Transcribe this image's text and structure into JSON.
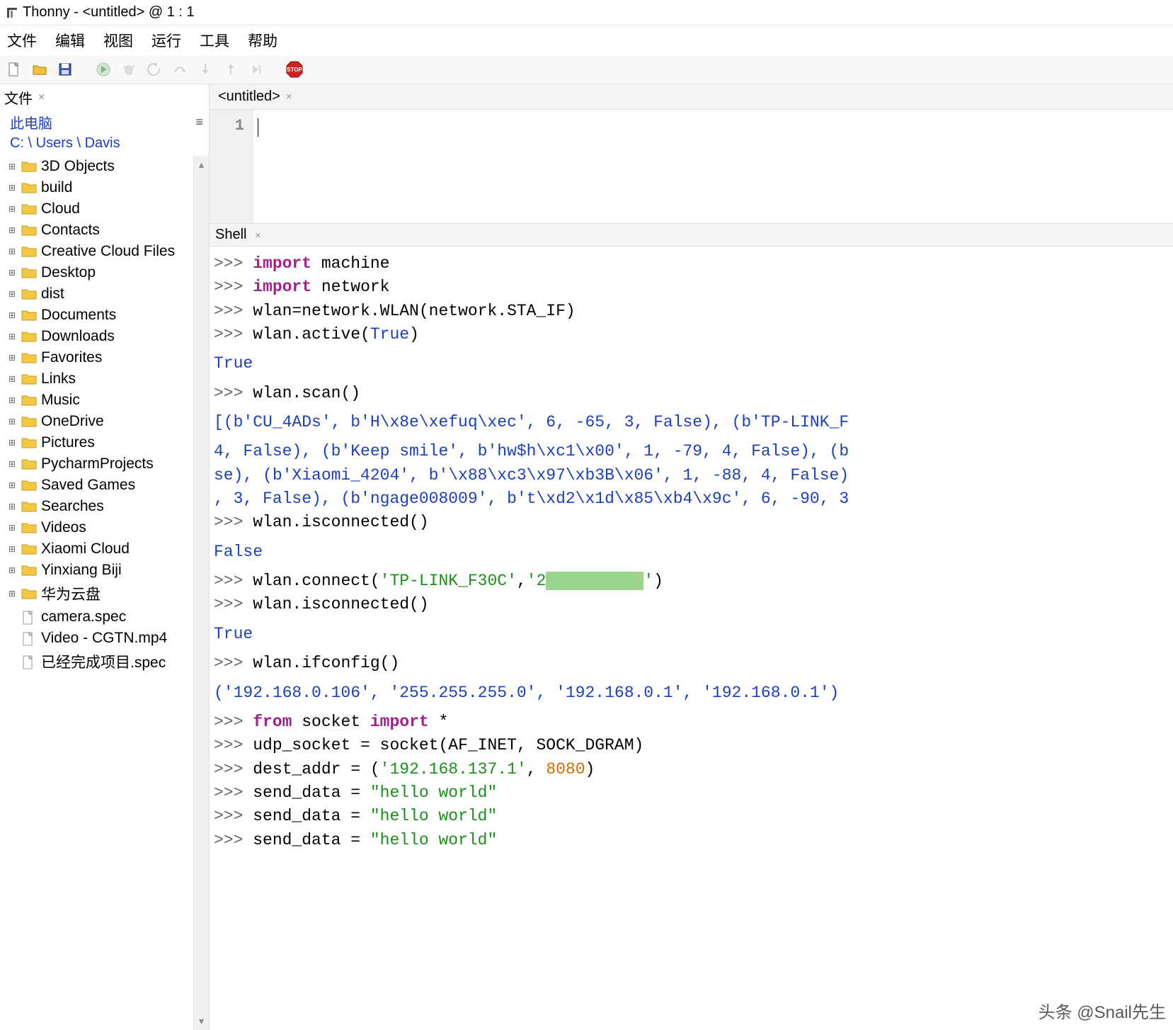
{
  "titlebar": {
    "text": "Thonny  -  <untitled>  @  1 : 1"
  },
  "menubar": {
    "items": [
      "文件",
      "编辑",
      "视图",
      "运行",
      "工具",
      "帮助"
    ]
  },
  "toolbar": {
    "buttons": [
      {
        "name": "new-file-icon"
      },
      {
        "name": "open-file-icon"
      },
      {
        "name": "save-file-icon"
      },
      {
        "name": "sep"
      },
      {
        "name": "run-icon"
      },
      {
        "name": "debug-icon"
      },
      {
        "name": "step-back-icon"
      },
      {
        "name": "step-over-icon"
      },
      {
        "name": "step-into-icon"
      },
      {
        "name": "step-out-icon"
      },
      {
        "name": "resume-icon"
      },
      {
        "name": "sep"
      },
      {
        "name": "stop-icon"
      }
    ]
  },
  "sidebar": {
    "tab_label": "文件",
    "location_label": "此电脑",
    "path": "C: \\ Users \\ Davis",
    "items": [
      {
        "type": "folder",
        "label": "3D Objects"
      },
      {
        "type": "folder",
        "label": "build"
      },
      {
        "type": "folder",
        "label": "Cloud"
      },
      {
        "type": "folder",
        "label": "Contacts"
      },
      {
        "type": "folder",
        "label": "Creative Cloud Files"
      },
      {
        "type": "folder",
        "label": "Desktop"
      },
      {
        "type": "folder",
        "label": "dist"
      },
      {
        "type": "folder",
        "label": "Documents"
      },
      {
        "type": "folder",
        "label": "Downloads"
      },
      {
        "type": "folder",
        "label": "Favorites"
      },
      {
        "type": "folder",
        "label": "Links"
      },
      {
        "type": "folder",
        "label": "Music"
      },
      {
        "type": "folder",
        "label": "OneDrive"
      },
      {
        "type": "folder",
        "label": "Pictures"
      },
      {
        "type": "folder",
        "label": "PycharmProjects"
      },
      {
        "type": "folder",
        "label": "Saved Games"
      },
      {
        "type": "folder",
        "label": "Searches"
      },
      {
        "type": "folder",
        "label": "Videos"
      },
      {
        "type": "folder",
        "label": "Xiaomi Cloud"
      },
      {
        "type": "folder",
        "label": "Yinxiang Biji"
      },
      {
        "type": "folder",
        "label": "华为云盘"
      },
      {
        "type": "file",
        "label": "camera.spec"
      },
      {
        "type": "file",
        "label": "Video - CGTN.mp4"
      },
      {
        "type": "file",
        "label": "已经完成项目.spec"
      }
    ]
  },
  "editor": {
    "tab_label": "<untitled>",
    "line_number": "1"
  },
  "shell": {
    "tab_label": "Shell",
    "lines": [
      {
        "t": "in",
        "tokens": [
          [
            "kw",
            "import"
          ],
          [
            "sp",
            " "
          ],
          [
            "id",
            "machine"
          ]
        ]
      },
      {
        "t": "in",
        "tokens": [
          [
            "kw",
            "import"
          ],
          [
            "sp",
            " "
          ],
          [
            "id",
            "network"
          ]
        ]
      },
      {
        "t": "in",
        "tokens": [
          [
            "id",
            "wlan=network.WLAN(network.STA_IF)"
          ]
        ]
      },
      {
        "t": "in",
        "tokens": [
          [
            "id",
            "wlan.active("
          ],
          [
            "builtin",
            "True"
          ],
          [
            "id",
            ")"
          ]
        ]
      },
      {
        "t": "out",
        "tokens": [
          [
            "out",
            "True"
          ]
        ]
      },
      {
        "t": "in",
        "tokens": [
          [
            "id",
            "wlan.scan()"
          ]
        ]
      },
      {
        "t": "out",
        "tokens": [
          [
            "out",
            "[(b'CU_4ADs', b'H\\x8e\\xefuq\\xec', 6, -65, 3, False), (b'TP-LINK_F"
          ]
        ]
      },
      {
        "t": "outc",
        "tokens": [
          [
            "out",
            "4, False), (b'Keep smile', b'hw$h\\xc1\\x00', 1, -79, 4, False), (b"
          ]
        ]
      },
      {
        "t": "outc",
        "tokens": [
          [
            "out",
            "se), (b'Xiaomi_4204', b'\\x88\\xc3\\x97\\xb3B\\x06', 1, -88, 4, False)"
          ]
        ]
      },
      {
        "t": "outc",
        "tokens": [
          [
            "out",
            ", 3, False), (b'ngage008009', b't\\xd2\\x1d\\x85\\xb4\\x9c', 6, -90, 3"
          ]
        ]
      },
      {
        "t": "in",
        "tokens": [
          [
            "id",
            "wlan.isconnected()"
          ]
        ]
      },
      {
        "t": "out",
        "tokens": [
          [
            "out",
            "False"
          ]
        ]
      },
      {
        "t": "in",
        "tokens": [
          [
            "id",
            "wlan.connect("
          ],
          [
            "str",
            "'TP-LINK_F30C'"
          ],
          [
            "id",
            ","
          ],
          [
            "str",
            "'2"
          ],
          [
            "censor",
            "xxxxxxxxxx"
          ],
          [
            "str",
            "'"
          ],
          [
            "id",
            ")"
          ]
        ]
      },
      {
        "t": "in",
        "tokens": [
          [
            "id",
            "wlan.isconnected()"
          ]
        ]
      },
      {
        "t": "out",
        "tokens": [
          [
            "out",
            "True"
          ]
        ]
      },
      {
        "t": "in",
        "tokens": [
          [
            "id",
            "wlan.ifconfig()"
          ]
        ]
      },
      {
        "t": "out",
        "tokens": [
          [
            "out",
            "('192.168.0.106', '255.255.255.0', '192.168.0.1', '192.168.0.1')"
          ]
        ]
      },
      {
        "t": "in",
        "tokens": [
          [
            "kw",
            "from"
          ],
          [
            "sp",
            " "
          ],
          [
            "id",
            "socket "
          ],
          [
            "kw",
            "import"
          ],
          [
            "sp",
            " "
          ],
          [
            "id",
            "*"
          ]
        ]
      },
      {
        "t": "in",
        "tokens": [
          [
            "id",
            "udp_socket = socket(AF_INET, SOCK_DGRAM)"
          ]
        ]
      },
      {
        "t": "in",
        "tokens": [
          [
            "id",
            "dest_addr = ("
          ],
          [
            "str",
            "'192.168.137.1'"
          ],
          [
            "id",
            ", "
          ],
          [
            "num",
            "8080"
          ],
          [
            "id",
            ")"
          ]
        ]
      },
      {
        "t": "in",
        "tokens": [
          [
            "id",
            "send_data = "
          ],
          [
            "str",
            "\"hello world\""
          ]
        ]
      },
      {
        "t": "in",
        "tokens": [
          [
            "id",
            "send_data = "
          ],
          [
            "str",
            "\"hello world\""
          ]
        ]
      },
      {
        "t": "inpartial",
        "tokens": [
          [
            "id",
            "send_data = "
          ],
          [
            "str",
            "\"hello world\""
          ]
        ]
      }
    ]
  },
  "watermark": "头条 @Snail先生"
}
